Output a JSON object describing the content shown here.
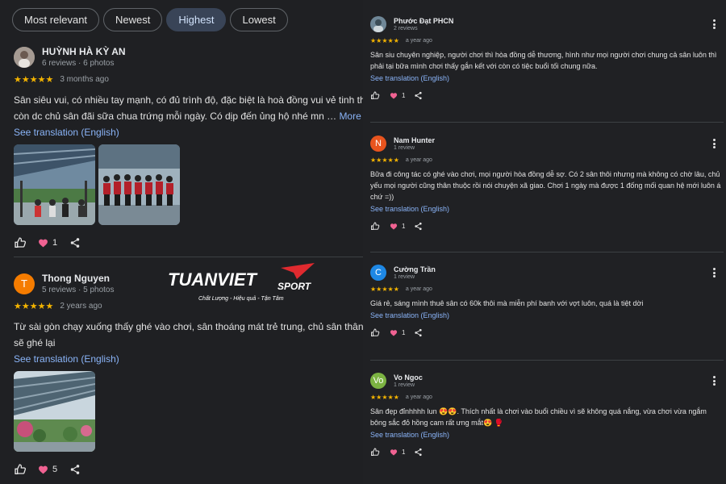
{
  "sort": {
    "options": [
      "Most relevant",
      "Newest",
      "Highest",
      "Lowest"
    ],
    "selected": "Highest"
  },
  "colors": {
    "star": "#f4b400",
    "link": "#8ab4f8",
    "heart": "#f06292",
    "chip_active": "#394457"
  },
  "left_reviews": [
    {
      "author": "HUỲNH HÀ KỲ AN",
      "meta": "6 reviews · 6 photos",
      "stars": "★★★★★",
      "ago": "3 months ago",
      "text_line1": "Sân siêu vui, có nhiều tay mạnh, có đủ trình độ, đặc biệt là hoà đồng vui vẻ tinh thần thể",
      "text_line2": "còn dc chủ sân đãi sữa chua trứng mỗi ngày. Có dịp đến ủng hộ nhé mn …",
      "more": "More",
      "translate": "See translation (English)",
      "likes": "1"
    },
    {
      "author": "Thong Nguyen",
      "avatar_letter": "T",
      "meta": "5 reviews · 5 photos",
      "stars": "★★★★★",
      "ago": "2 years ago",
      "text_line1": "Từ sài gòn chạy xuống thấy ghé vào chơi, sân thoáng mát trẻ trung, chủ sân thân thiện,",
      "text_line2": "sẽ ghé lại",
      "translate": "See translation (English)",
      "likes": "5"
    }
  ],
  "logo": {
    "brand": "TUANVIET",
    "sub": "SPORT",
    "tagline": "Chất Lượng - Hiệu quả - Tận Tâm"
  },
  "right_reviews": [
    {
      "author": "Phước Đạt PHCN",
      "meta": "2 reviews",
      "stars": "★★★★★",
      "ago": "a year ago",
      "text": "Sân siu chuyên nghiệp, người chơi thì hòa đồng dễ thương, hình như mọi người chơi chung cả sân luôn thì phải tại bữa mình chơi thấy gắn kết với còn có tiệc buổi tối chung nữa.",
      "translate": "See translation (English)",
      "likes": "1"
    },
    {
      "author": "Nam Hunter",
      "avatar_letter": "N",
      "meta": "1 review",
      "stars": "★★★★★",
      "ago": "a year ago",
      "text": "Bữa đi công tác có ghé vào chơi, mọi người hòa đồng dễ sợ. Có 2 sân thôi nhưng mà không có chờ lâu, chủ yếu mọi người cũng thân thuộc rồi nói chuyện xã giao. Chơi 1 ngày mà được 1 đống mối quan hệ mới luôn á chứ =))",
      "translate": "See translation (English)",
      "likes": "1"
    },
    {
      "author": "Cường Trần",
      "avatar_letter": "C",
      "meta": "1 review",
      "stars": "★★★★★",
      "ago": "a year ago",
      "text": "Giá rẻ, sáng mình thuê sân có 60k thôi mà miễn phí banh với vợt luôn, quá là tiệt dời",
      "translate": "See translation (English)",
      "likes": "1"
    },
    {
      "author": "Vo Ngoc",
      "avatar_letter": "Vo",
      "meta": "1 review",
      "stars": "★★★★★",
      "ago": "a year ago",
      "text": "Sân đẹp đỉnhhhh lun 😍😍. Thích nhất là chơi vào buổi chiều vì sẽ không quá nắng, vừa chơi vừa ngắm bông sắc đỏ hồng cam rất ưng mắt😍 🥊",
      "translate": "See translation (English)",
      "likes": "1"
    }
  ]
}
